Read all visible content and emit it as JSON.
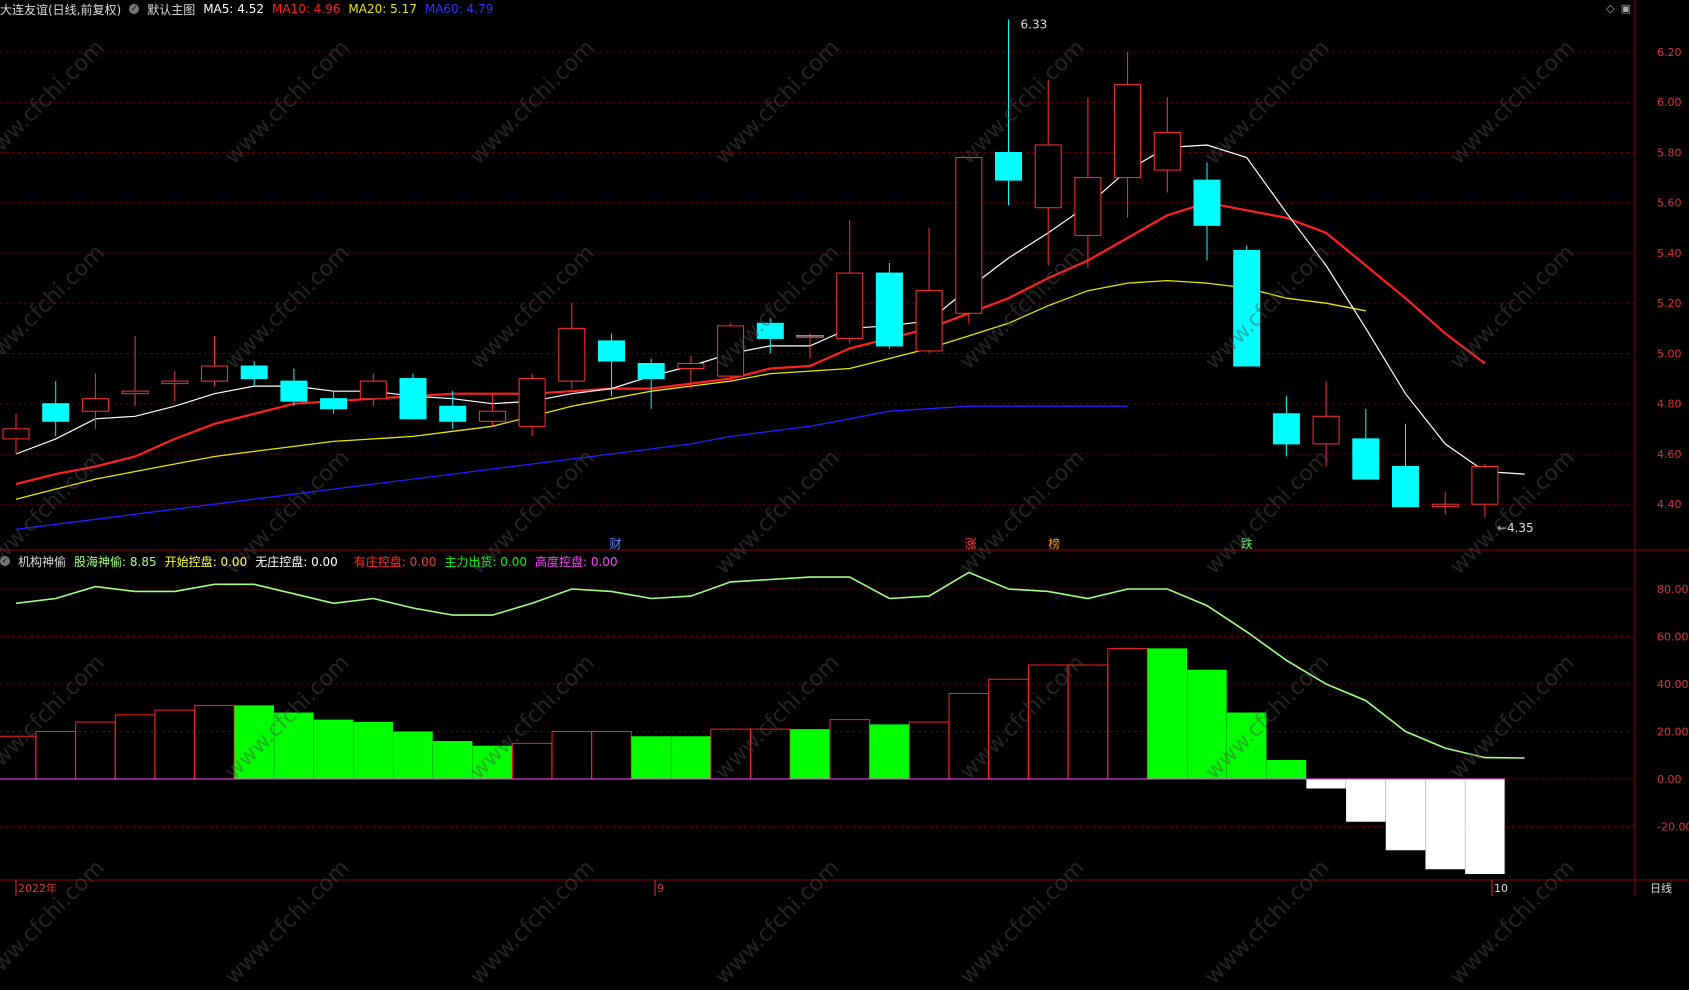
{
  "header_main": {
    "stock": "大连友谊(日线,前复权)",
    "template": "默认主图",
    "ma5_label": "MA5:",
    "ma5_value": "4.52",
    "ma10_label": "MA10:",
    "ma10_value": "4.96",
    "ma20_label": "MA20:",
    "ma20_value": "5.17",
    "ma60_label": "MA60:",
    "ma60_value": "4.79"
  },
  "header_sub": {
    "name": "机构神偷",
    "guhai_label": "股海神偷:",
    "guhai_value": "8.85",
    "start_label": "开始控盘:",
    "start_value": "0.00",
    "none_label": "无庄控盘:",
    "none_value": "0.00",
    "has_label": "有庄控盘:",
    "has_value": "0.00",
    "out_label": "主力出货:",
    "out_value": "0.00",
    "high_label": "高度控盘:",
    "high_value": "0.00"
  },
  "colors": {
    "up": "#ff3232",
    "down": "#00ffff",
    "ma5": "#ffffff",
    "ma10": "#ff2020",
    "ma20": "#e6e600",
    "ma60": "#2020ff",
    "guhai": "#a0ff80",
    "green_bar": "#00ff00",
    "white_bar": "#ffffff",
    "grid": "#5a0000"
  },
  "price_axis": [
    "6.20",
    "6.00",
    "5.80",
    "5.60",
    "5.40",
    "5.20",
    "5.00",
    "4.80",
    "4.60",
    "4.40"
  ],
  "sub_axis": [
    "80.00",
    "60.00",
    "40.00",
    "20.00",
    "0.00",
    "-20.00"
  ],
  "annotations": {
    "high": "6.33",
    "low": "←4.35"
  },
  "events": [
    {
      "text": "财",
      "color": "#6080ff"
    },
    {
      "text": "涨",
      "color": "#ff4040"
    },
    {
      "text": "榜",
      "color": "#ff9a00"
    },
    {
      "text": "跌",
      "color": "#60ff60"
    }
  ],
  "bottom_axis": {
    "year": "2022年",
    "m9": "9",
    "m10": "10",
    "period": "日线"
  },
  "watermark": "www.cfchi.com",
  "icons": [
    "diamond-icon",
    "window-icon"
  ],
  "chart_data": {
    "type": "candlestick",
    "price_ylim": [
      4.3,
      6.35
    ],
    "candles": [
      {
        "o": 4.66,
        "h": 4.76,
        "l": 4.6,
        "c": 4.7
      },
      {
        "o": 4.8,
        "h": 4.89,
        "l": 4.67,
        "c": 4.73
      },
      {
        "o": 4.77,
        "h": 4.92,
        "l": 4.7,
        "c": 4.82
      },
      {
        "o": 4.84,
        "h": 5.07,
        "l": 4.79,
        "c": 4.85
      },
      {
        "o": 4.88,
        "h": 4.93,
        "l": 4.81,
        "c": 4.89
      },
      {
        "o": 4.89,
        "h": 5.07,
        "l": 4.87,
        "c": 4.95
      },
      {
        "o": 4.95,
        "h": 4.97,
        "l": 4.87,
        "c": 4.9
      },
      {
        "o": 4.89,
        "h": 4.94,
        "l": 4.79,
        "c": 4.81
      },
      {
        "o": 4.82,
        "h": 4.85,
        "l": 4.76,
        "c": 4.78
      },
      {
        "o": 4.82,
        "h": 4.92,
        "l": 4.79,
        "c": 4.89
      },
      {
        "o": 4.9,
        "h": 4.92,
        "l": 4.74,
        "c": 4.74
      },
      {
        "o": 4.79,
        "h": 4.85,
        "l": 4.7,
        "c": 4.73
      },
      {
        "o": 4.73,
        "h": 4.84,
        "l": 4.71,
        "c": 4.77
      },
      {
        "o": 4.71,
        "h": 4.92,
        "l": 4.67,
        "c": 4.9
      },
      {
        "o": 4.89,
        "h": 5.2,
        "l": 4.86,
        "c": 5.1
      },
      {
        "o": 5.05,
        "h": 5.08,
        "l": 4.83,
        "c": 4.97
      },
      {
        "o": 4.96,
        "h": 4.98,
        "l": 4.78,
        "c": 4.9
      },
      {
        "o": 4.94,
        "h": 4.99,
        "l": 4.86,
        "c": 4.96
      },
      {
        "o": 4.91,
        "h": 5.12,
        "l": 4.89,
        "c": 5.11
      },
      {
        "o": 5.12,
        "h": 5.14,
        "l": 5.0,
        "c": 5.06
      },
      {
        "o": 5.07,
        "h": 5.08,
        "l": 4.98,
        "c": 5.07
      },
      {
        "o": 5.06,
        "h": 5.53,
        "l": 5.04,
        "c": 5.32
      },
      {
        "o": 5.32,
        "h": 5.36,
        "l": 5.02,
        "c": 5.03
      },
      {
        "o": 5.01,
        "h": 5.5,
        "l": 5.0,
        "c": 5.25
      },
      {
        "o": 5.16,
        "h": 5.78,
        "l": 5.12,
        "c": 5.78
      },
      {
        "o": 5.8,
        "h": 6.33,
        "l": 5.59,
        "c": 5.69
      },
      {
        "o": 5.58,
        "h": 6.09,
        "l": 5.35,
        "c": 5.83
      },
      {
        "o": 5.47,
        "h": 6.02,
        "l": 5.34,
        "c": 5.7
      },
      {
        "o": 5.7,
        "h": 6.2,
        "l": 5.54,
        "c": 6.07
      },
      {
        "o": 5.73,
        "h": 6.02,
        "l": 5.64,
        "c": 5.88
      },
      {
        "o": 5.69,
        "h": 5.76,
        "l": 5.37,
        "c": 5.51
      },
      {
        "o": 5.41,
        "h": 5.43,
        "l": 4.95,
        "c": 4.95
      },
      {
        "o": 4.76,
        "h": 4.83,
        "l": 4.59,
        "c": 4.64
      },
      {
        "o": 4.64,
        "h": 4.89,
        "l": 4.55,
        "c": 4.75
      },
      {
        "o": 4.66,
        "h": 4.78,
        "l": 4.5,
        "c": 4.5
      },
      {
        "o": 4.55,
        "h": 4.72,
        "l": 4.39,
        "c": 4.39
      },
      {
        "o": 4.39,
        "h": 4.45,
        "l": 4.36,
        "c": 4.4
      },
      {
        "o": 4.4,
        "h": 4.56,
        "l": 4.35,
        "c": 4.55
      }
    ],
    "ma5": [
      4.6,
      4.66,
      4.74,
      4.75,
      4.79,
      4.84,
      4.87,
      4.87,
      4.85,
      4.85,
      4.83,
      4.82,
      4.8,
      4.81,
      4.84,
      4.86,
      4.91,
      4.95,
      5.0,
      5.03,
      5.03,
      5.1,
      5.11,
      5.13,
      5.26,
      5.38,
      5.48,
      5.59,
      5.73,
      5.82,
      5.83,
      5.78,
      5.56,
      5.35,
      5.1,
      4.84,
      4.64,
      4.53,
      4.52
    ],
    "ma10": [
      4.48,
      4.52,
      4.55,
      4.59,
      4.66,
      4.72,
      4.76,
      4.8,
      4.81,
      4.82,
      4.83,
      4.84,
      4.84,
      4.84,
      4.85,
      4.86,
      4.86,
      4.88,
      4.9,
      4.94,
      4.95,
      5.02,
      5.06,
      5.1,
      5.16,
      5.22,
      5.3,
      5.37,
      5.46,
      5.55,
      5.6,
      5.57,
      5.54,
      5.48,
      5.35,
      5.22,
      5.08,
      4.96
    ],
    "ma20": [
      4.42,
      4.46,
      4.5,
      4.53,
      4.56,
      4.59,
      4.61,
      4.63,
      4.65,
      4.66,
      4.67,
      4.69,
      4.71,
      4.75,
      4.79,
      4.82,
      4.85,
      4.87,
      4.89,
      4.92,
      4.93,
      4.94,
      4.98,
      5.02,
      5.07,
      5.12,
      5.19,
      5.25,
      5.28,
      5.29,
      5.28,
      5.26,
      5.22,
      5.2,
      5.17
    ],
    "ma60": [
      4.3,
      4.32,
      4.34,
      4.36,
      4.38,
      4.4,
      4.42,
      4.44,
      4.46,
      4.48,
      4.5,
      4.52,
      4.54,
      4.56,
      4.58,
      4.6,
      4.62,
      4.64,
      4.67,
      4.69,
      4.71,
      4.74,
      4.77,
      4.78,
      4.79,
      4.79,
      4.79,
      4.79,
      4.79
    ],
    "sub_ylim": [
      -40,
      90
    ],
    "guhai": [
      74,
      76,
      81,
      79,
      79,
      82,
      82,
      78,
      74,
      76,
      72,
      69,
      69,
      74,
      80,
      79,
      76,
      77,
      83,
      84,
      85,
      85,
      76,
      77,
      87,
      80,
      79,
      76,
      80,
      80,
      73,
      62,
      50,
      40,
      33,
      20,
      13,
      9,
      8.85
    ],
    "bars": [
      {
        "v": 18,
        "t": "r"
      },
      {
        "v": 20,
        "t": "r"
      },
      {
        "v": 24,
        "t": "r"
      },
      {
        "v": 27,
        "t": "r"
      },
      {
        "v": 29,
        "t": "r"
      },
      {
        "v": 31,
        "t": "r"
      },
      {
        "v": 31,
        "t": "g"
      },
      {
        "v": 28,
        "t": "g"
      },
      {
        "v": 25,
        "t": "g"
      },
      {
        "v": 24,
        "t": "g"
      },
      {
        "v": 20,
        "t": "g"
      },
      {
        "v": 16,
        "t": "g"
      },
      {
        "v": 14,
        "t": "g"
      },
      {
        "v": 15,
        "t": "r"
      },
      {
        "v": 20,
        "t": "r"
      },
      {
        "v": 20,
        "t": "r"
      },
      {
        "v": 18,
        "t": "g"
      },
      {
        "v": 18,
        "t": "g"
      },
      {
        "v": 21,
        "t": "r"
      },
      {
        "v": 21,
        "t": "r"
      },
      {
        "v": 21,
        "t": "g"
      },
      {
        "v": 25,
        "t": "r"
      },
      {
        "v": 23,
        "t": "g"
      },
      {
        "v": 24,
        "t": "r"
      },
      {
        "v": 36,
        "t": "r"
      },
      {
        "v": 42,
        "t": "r"
      },
      {
        "v": 48,
        "t": "r"
      },
      {
        "v": 48,
        "t": "r"
      },
      {
        "v": 55,
        "t": "r"
      },
      {
        "v": 55,
        "t": "g"
      },
      {
        "v": 46,
        "t": "g"
      },
      {
        "v": 28,
        "t": "g"
      },
      {
        "v": 8,
        "t": "g"
      },
      {
        "v": -4,
        "t": "w"
      },
      {
        "v": -18,
        "t": "w"
      },
      {
        "v": -30,
        "t": "w"
      },
      {
        "v": -38,
        "t": "w"
      },
      {
        "v": -40,
        "t": "w"
      }
    ]
  }
}
